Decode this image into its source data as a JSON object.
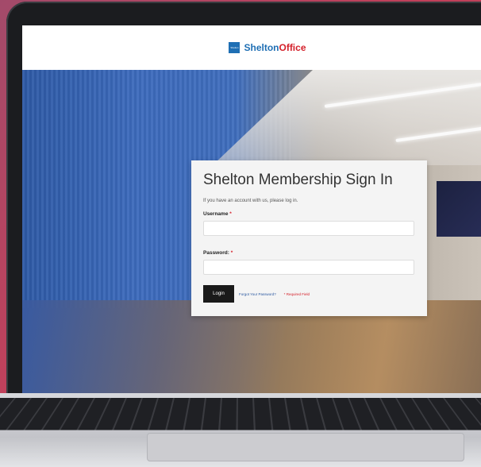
{
  "header": {
    "logo_mark_text": "Shelton",
    "logo_name_primary": "Shelton",
    "logo_name_accent": "Office"
  },
  "login": {
    "title": "Shelton Membership Sign In",
    "intro": "If you have an account with us, please log in.",
    "username_label": "Username",
    "username_required_mark": "*",
    "username_value": "",
    "password_label": "Password:",
    "password_required_mark": "*",
    "password_value": "",
    "login_button": "Login",
    "forgot_password_link": "Forgot Your Password?",
    "required_note": "* Required Field"
  },
  "colors": {
    "brand_blue": "#1f6fb4",
    "brand_red": "#d4202a",
    "button_dark": "#1a1a1a",
    "background_pink": "#c2405a"
  }
}
